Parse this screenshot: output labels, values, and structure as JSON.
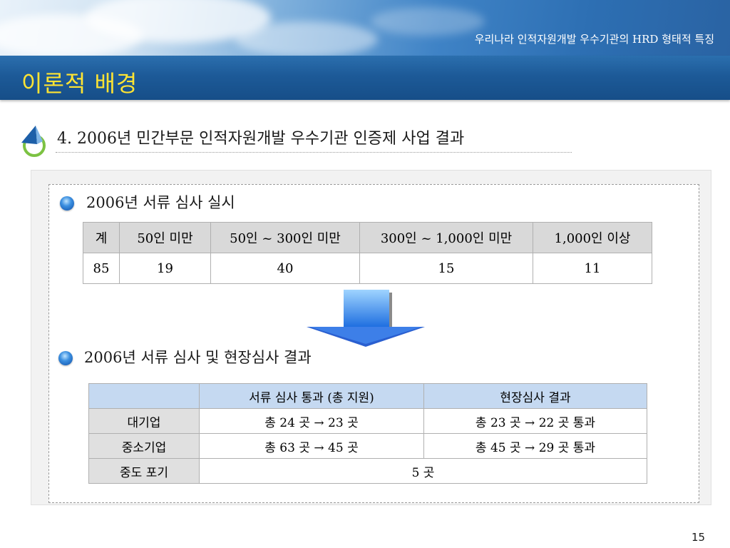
{
  "header": {
    "subtitle": "우리나라 인적자원개발 우수기관의 HRD 형태적 특징",
    "title": "이론적 배경"
  },
  "section": {
    "heading": "4. 2006년 민간부문 인적자원개발 우수기관 인증제 사업 결과"
  },
  "part1": {
    "label": "2006년 서류 심사 실시",
    "headers": [
      "계",
      "50인 미만",
      "50인 ~ 300인 미만",
      "300인 ~ 1,000인 미만",
      "1,000인 이상"
    ],
    "values": [
      "85",
      "19",
      "40",
      "15",
      "11"
    ]
  },
  "part2": {
    "label": "2006년 서류 심사 및 현장심사 결과",
    "headers": [
      "",
      "서류 심사 통과 (총 지원)",
      "현장심사 결과"
    ],
    "rows": [
      {
        "name": "대기업",
        "doc": "총 24 곳 → 23 곳",
        "site": "총 23 곳 → 22 곳 통과"
      },
      {
        "name": "중소기업",
        "doc": "총 63 곳 → 45 곳",
        "site": "총 45 곳 → 29 곳 통과"
      },
      {
        "name": "중도 포기",
        "merged": "5 곳"
      }
    ]
  },
  "page_number": "15",
  "colors": {
    "title": "#ffe433",
    "titlebar": "#1d5a98",
    "table_header_gray": "#d9d9d9",
    "table_header_blue": "#c5d9f1"
  }
}
